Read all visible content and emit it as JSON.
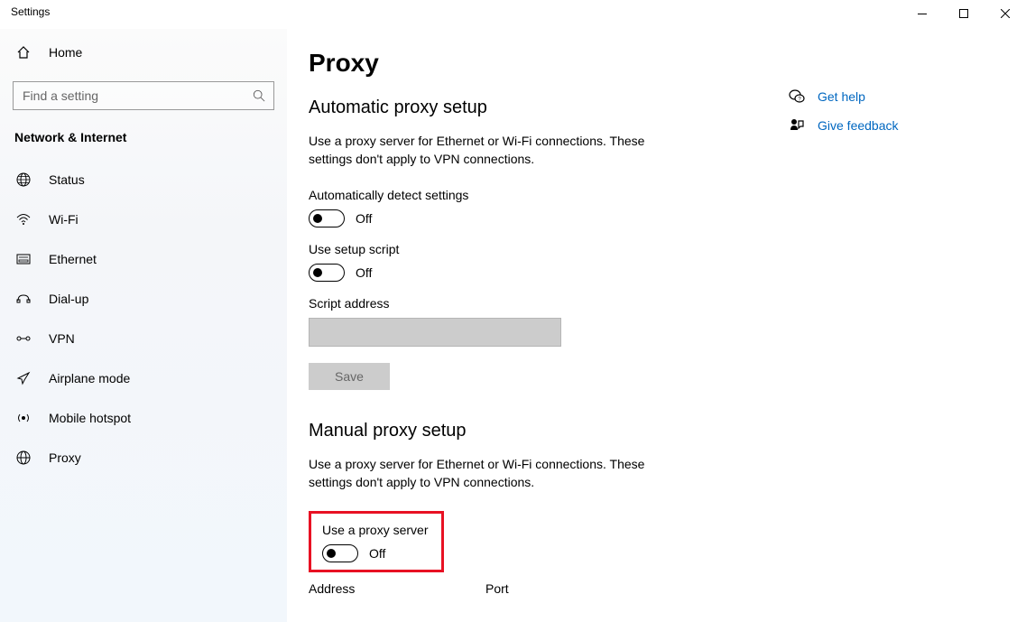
{
  "window": {
    "title": "Settings"
  },
  "sidebar": {
    "home_label": "Home",
    "search_placeholder": "Find a setting",
    "category_title": "Network & Internet",
    "items": [
      {
        "label": "Status"
      },
      {
        "label": "Wi-Fi"
      },
      {
        "label": "Ethernet"
      },
      {
        "label": "Dial-up"
      },
      {
        "label": "VPN"
      },
      {
        "label": "Airplane mode"
      },
      {
        "label": "Mobile hotspot"
      },
      {
        "label": "Proxy"
      }
    ]
  },
  "content": {
    "page_title": "Proxy",
    "auto_section": {
      "title": "Automatic proxy setup",
      "desc": "Use a proxy server for Ethernet or Wi-Fi connections. These settings don't apply to VPN connections.",
      "detect_label": "Automatically detect settings",
      "detect_state": "Off",
      "script_label": "Use setup script",
      "script_state": "Off",
      "address_label": "Script address",
      "address_value": "",
      "save_label": "Save"
    },
    "manual_section": {
      "title": "Manual proxy setup",
      "desc": "Use a proxy server for Ethernet or Wi-Fi connections. These settings don't apply to VPN connections.",
      "use_proxy_label": "Use a proxy server",
      "use_proxy_state": "Off",
      "address_label": "Address",
      "port_label": "Port"
    },
    "help": {
      "get_help": "Get help",
      "feedback": "Give feedback"
    }
  }
}
